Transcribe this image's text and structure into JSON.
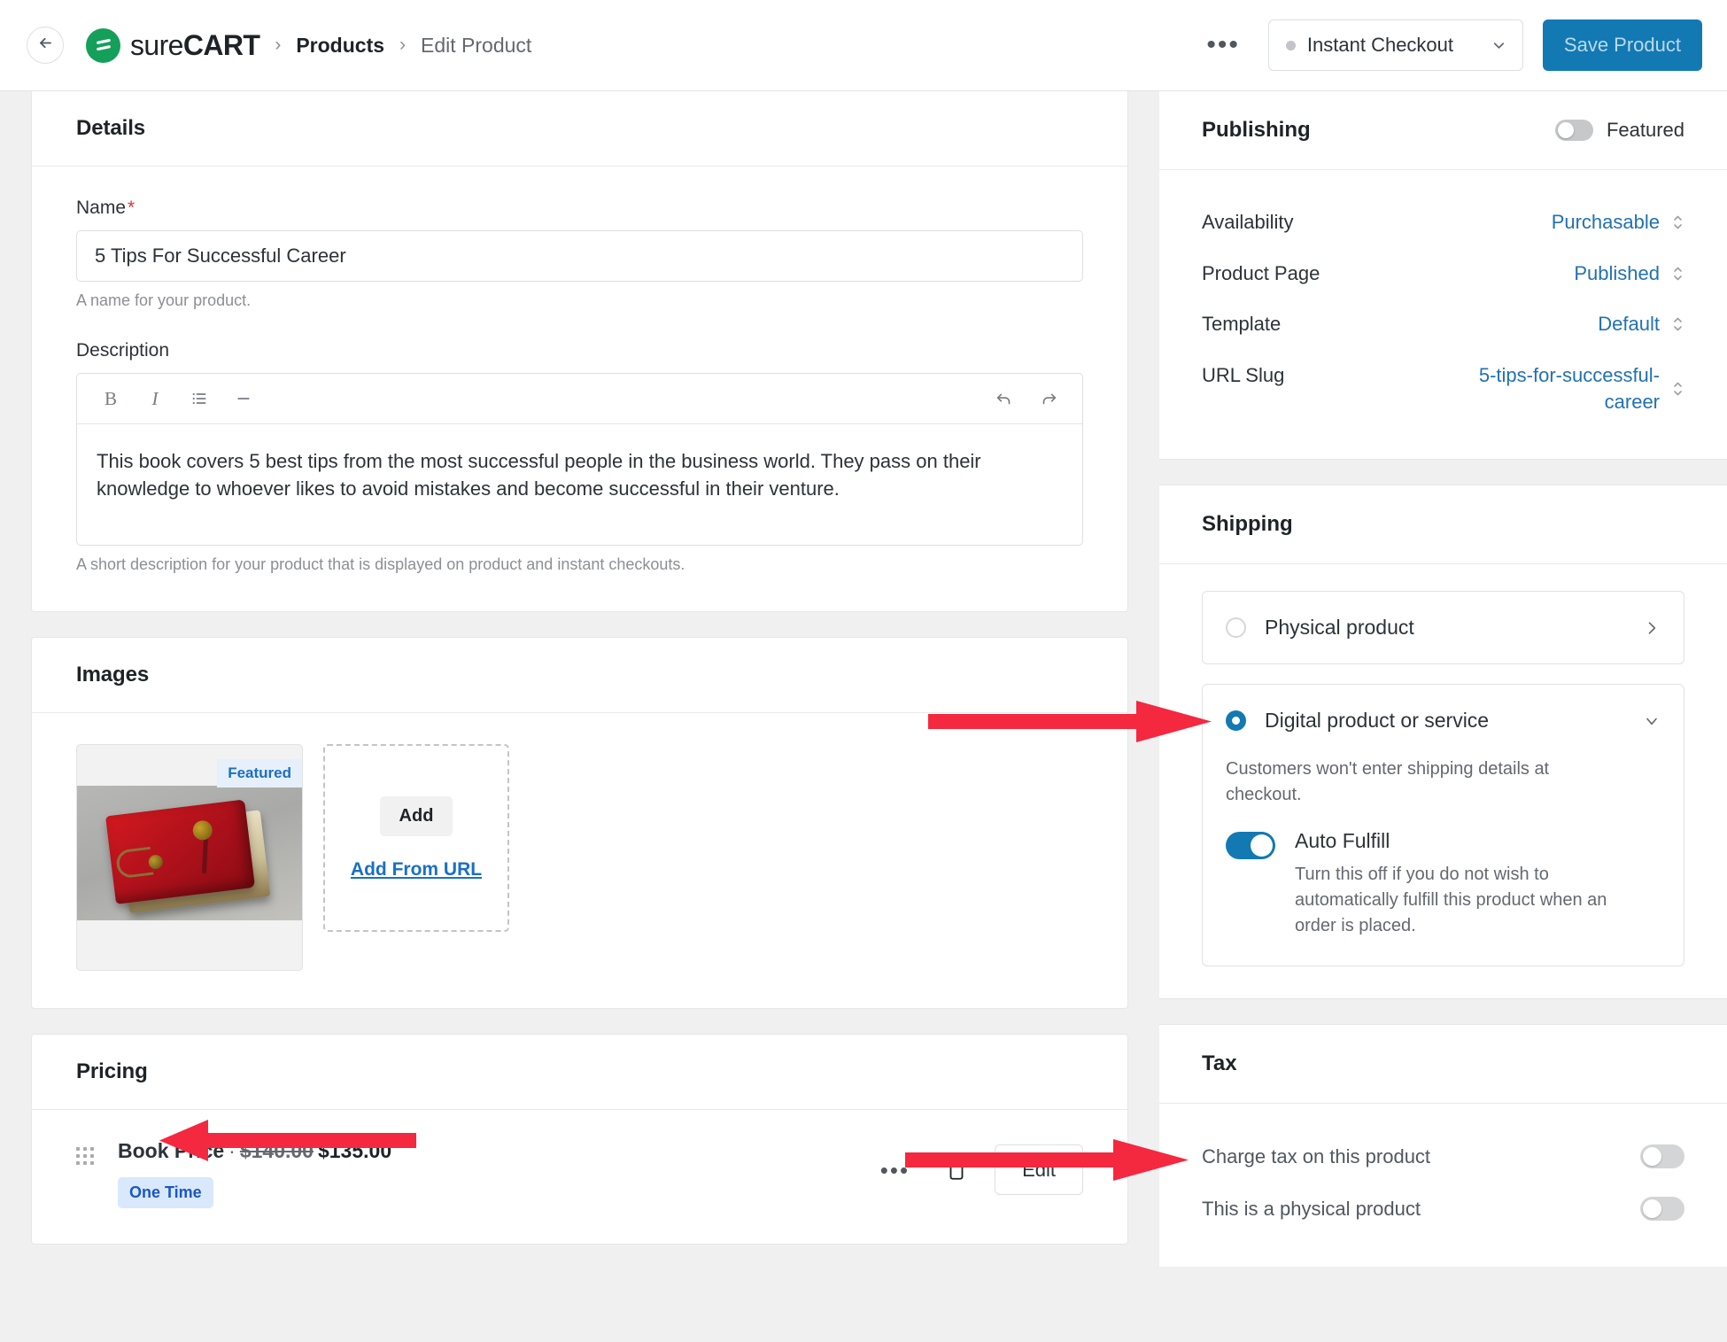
{
  "header": {
    "back_icon": "arrow-left-icon",
    "brand_sure": "sure",
    "brand_cart": "CART",
    "breadcrumb": [
      "Products",
      "Edit Product"
    ],
    "overflow_label": "•••",
    "checkout_select": "Instant Checkout",
    "save_label": "Save Product"
  },
  "details": {
    "title": "Details",
    "name_label": "Name",
    "name_required": "*",
    "name_value": "5 Tips For Successful Career",
    "name_help": "A name for your product.",
    "description_label": "Description",
    "toolbar": [
      "B",
      "I",
      "list-icon",
      "horizontal-rule-icon",
      "undo-icon",
      "redo-icon"
    ],
    "description_value": "This book covers 5 best tips from the most successful people in the business world. They pass on their knowledge to whoever likes to avoid mistakes and become successful in their venture.",
    "description_help": "A short description for your product that is displayed on product and instant checkouts."
  },
  "images": {
    "title": "Images",
    "featured_badge": "Featured",
    "add_label": "Add",
    "add_url_label": "Add From URL"
  },
  "pricing": {
    "title": "Pricing",
    "price_name": "Book Price",
    "separator": "·",
    "old_price": "$140.00",
    "new_price": "$135.00",
    "badge": "One Time",
    "overflow_label": "•••",
    "copy_icon": "clipboard-icon",
    "edit_label": "Edit"
  },
  "publishing": {
    "title": "Publishing",
    "featured_label": "Featured",
    "featured_on": false,
    "rows": [
      {
        "key": "Availability",
        "value": "Purchasable"
      },
      {
        "key": "Product Page",
        "value": "Published"
      },
      {
        "key": "Template",
        "value": "Default"
      },
      {
        "key": "URL Slug",
        "value": "5-tips-for-successful-career"
      }
    ]
  },
  "shipping": {
    "title": "Shipping",
    "physical": {
      "label": "Physical product",
      "selected": false
    },
    "digital": {
      "label": "Digital product or service",
      "selected": true,
      "description": "Customers won't enter shipping details at checkout.",
      "auto_fulfill_label": "Auto Fulfill",
      "auto_fulfill_on": true,
      "auto_fulfill_desc": "Turn this off if you do not wish to automatically fulfill this product when an order is placed."
    }
  },
  "tax": {
    "title": "Tax",
    "rows": [
      {
        "label": "Charge tax on this product",
        "on": false
      },
      {
        "label": "This is a physical product",
        "on": false
      }
    ]
  },
  "annotations": {
    "color": "#f4283f",
    "arrows": [
      {
        "name": "arrow-to-physical-product",
        "direction": "right"
      },
      {
        "name": "arrow-to-pricing",
        "direction": "left"
      },
      {
        "name": "arrow-to-tax",
        "direction": "right"
      }
    ]
  },
  "colors": {
    "brand_green": "#14a05a",
    "accent_blue": "#1279b3",
    "link_blue": "#2271b1",
    "annotation_red": "#f4283f"
  }
}
